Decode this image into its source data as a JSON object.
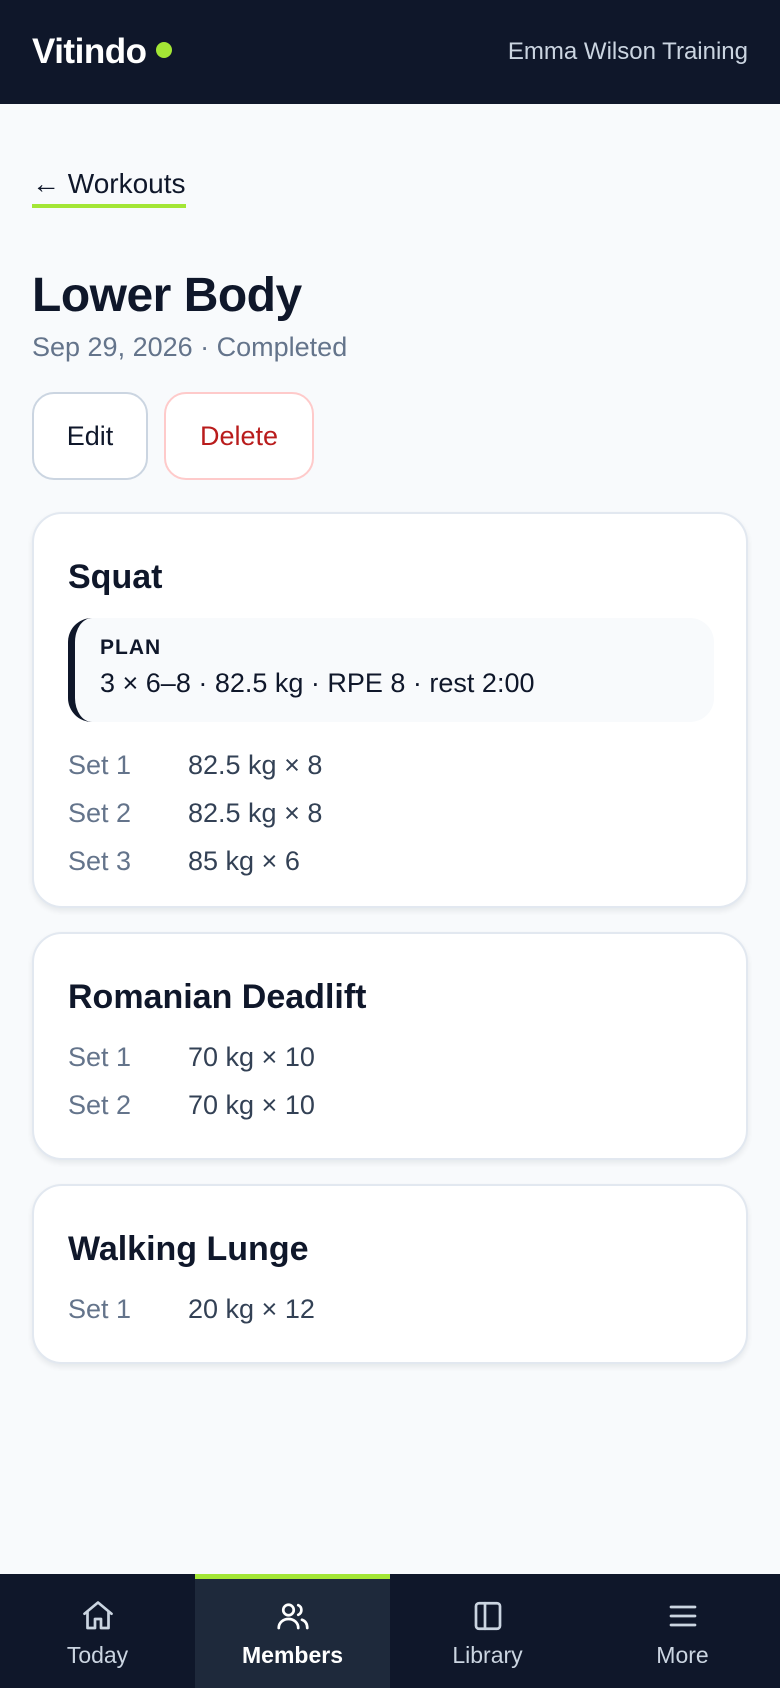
{
  "header": {
    "brand": "Vitindo",
    "account": "Emma Wilson Training"
  },
  "nav_back": {
    "label": "← Workouts"
  },
  "workout": {
    "title": "Lower Body",
    "subtitle": "Sep 29, 2026 · Completed"
  },
  "actions": {
    "edit": "Edit",
    "delete": "Delete"
  },
  "exercises": [
    {
      "name": "Squat",
      "plan_label": "PLAN",
      "plan": "3 × 6–8 · 82.5 kg · RPE 8 · rest 2:00",
      "sets": [
        {
          "label": "Set 1",
          "value": "82.5 kg × 8"
        },
        {
          "label": "Set 2",
          "value": "82.5 kg × 8"
        },
        {
          "label": "Set 3",
          "value": "85 kg × 6"
        }
      ]
    },
    {
      "name": "Romanian Deadlift",
      "sets": [
        {
          "label": "Set 1",
          "value": "70 kg × 10"
        },
        {
          "label": "Set 2",
          "value": "70 kg × 10"
        }
      ]
    },
    {
      "name": "Walking Lunge",
      "sets": [
        {
          "label": "Set 1",
          "value": "20 kg × 12"
        }
      ]
    }
  ],
  "bottom_nav": [
    {
      "label": "Today",
      "icon": "home-icon"
    },
    {
      "label": "Members",
      "icon": "users-icon",
      "active": true
    },
    {
      "label": "Library",
      "icon": "library-icon"
    },
    {
      "label": "More",
      "icon": "menu-icon"
    }
  ],
  "colors": {
    "header_bg": "#0f172a",
    "accent": "#a3e635",
    "danger": "#b91c1c"
  }
}
